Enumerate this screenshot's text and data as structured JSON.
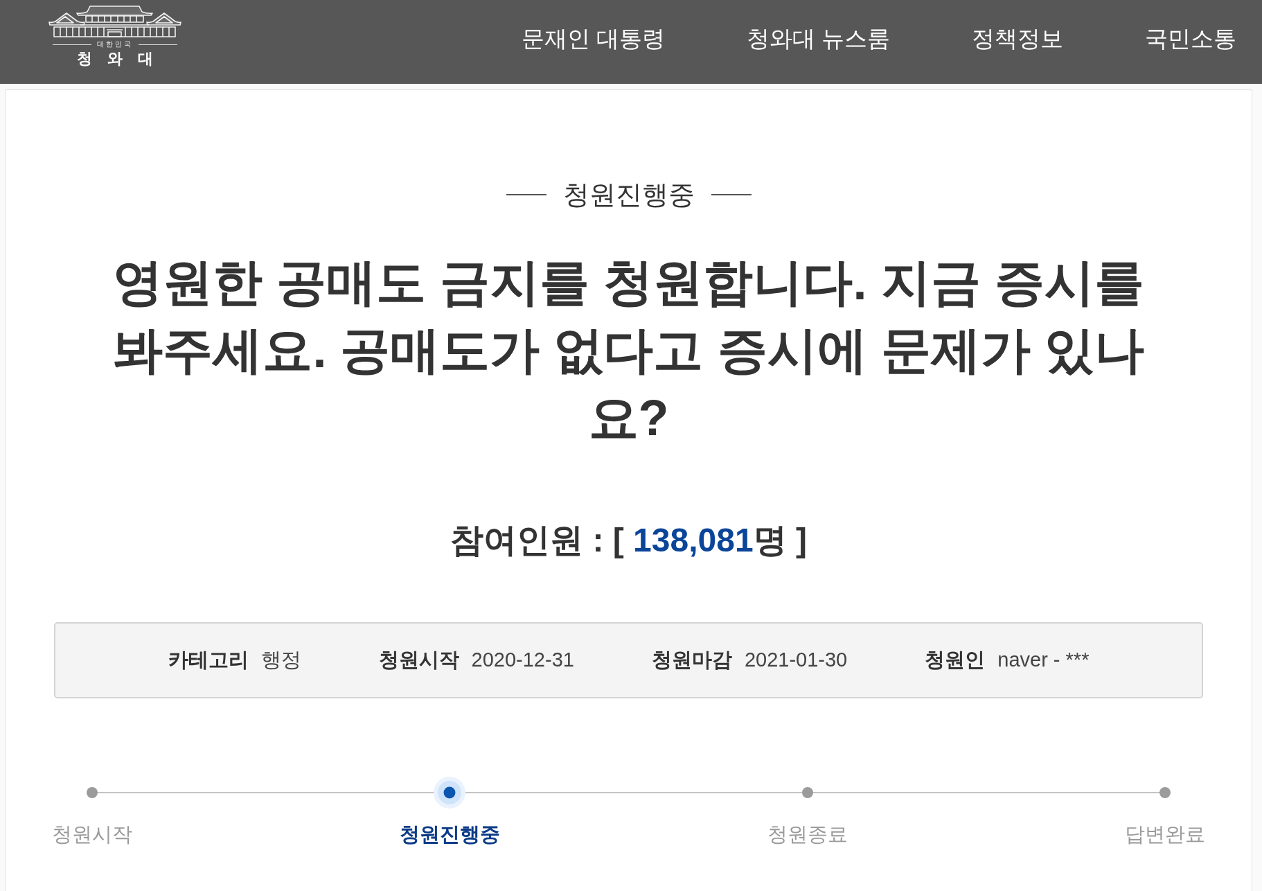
{
  "header": {
    "logo": {
      "tagline": "대한민국",
      "name": "청 와 대"
    },
    "nav": [
      "문재인 대통령",
      "청와대 뉴스룸",
      "정책정보",
      "국민소통"
    ]
  },
  "petition": {
    "status": "청원진행중",
    "title": "영원한 공매도 금지를 청원합니다. 지금 증시를 봐주세요. 공매도가 없다고 증시에 문제가 있나요?",
    "participants": {
      "label": "참여인원 : [",
      "count": "138,081",
      "suffix": "명 ]"
    },
    "details": [
      {
        "label": "카테고리",
        "value": "행정"
      },
      {
        "label": "청원시작",
        "value": "2020-12-31"
      },
      {
        "label": "청원마감",
        "value": "2021-01-30"
      },
      {
        "label": "청원인",
        "value": "naver - ***"
      }
    ],
    "steps": [
      {
        "label": "청원시작",
        "current": false
      },
      {
        "label": "청원진행중",
        "current": true
      },
      {
        "label": "청원종료",
        "current": false
      },
      {
        "label": "답변완료",
        "current": false
      }
    ]
  }
}
